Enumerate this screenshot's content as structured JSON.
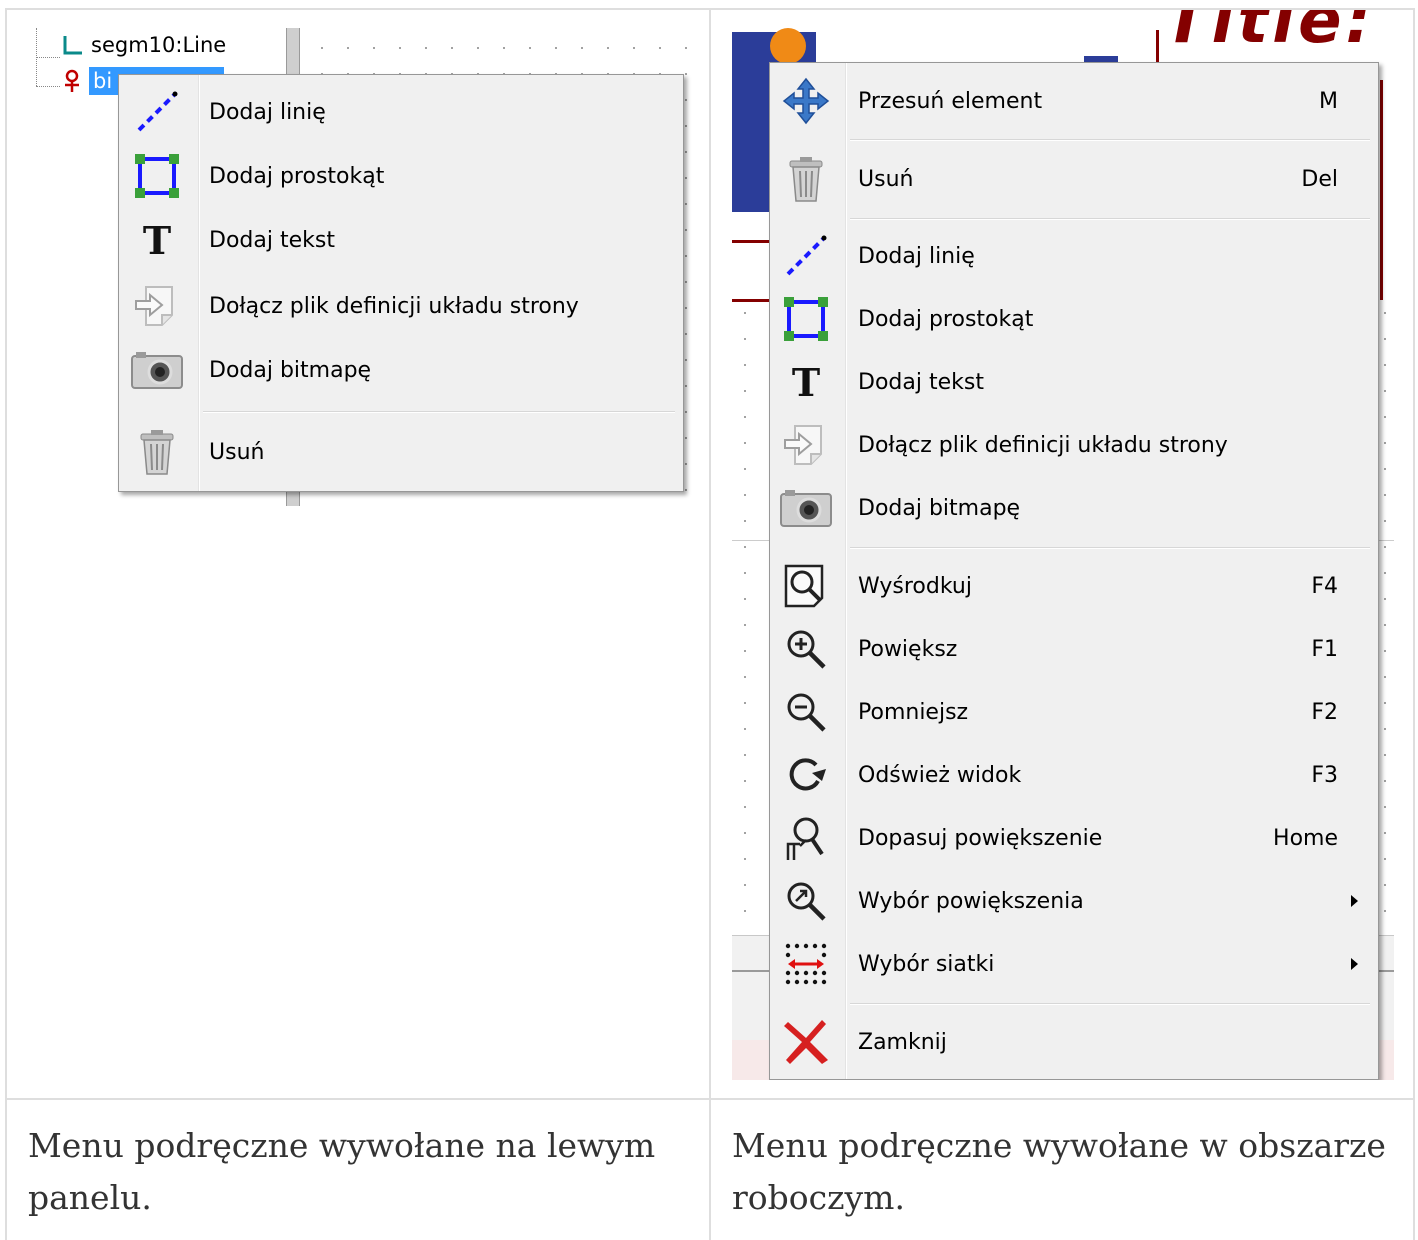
{
  "left": {
    "tree": {
      "item_1": "segm10:Line",
      "item_2": "bi"
    },
    "menu": [
      {
        "label": "Dodaj linię",
        "icon": "add-line-icon"
      },
      {
        "label": "Dodaj prostokąt",
        "icon": "add-rectangle-icon"
      },
      {
        "label": "Dodaj tekst",
        "icon": "add-text-icon"
      },
      {
        "label": "Dołącz plik definicji układu strony",
        "icon": "append-file-icon"
      },
      {
        "label": "Dodaj bitmapę",
        "icon": "camera-icon"
      },
      {
        "label": "Usuń",
        "icon": "trash-icon"
      }
    ],
    "caption": "Menu podręczne wywołane na lewym panelu."
  },
  "right": {
    "background": {
      "title_fragment": "Title:"
    },
    "menu": [
      {
        "label": "Przesuń element",
        "shortcut": "M",
        "icon": "move-icon"
      },
      {
        "label": "Usuń",
        "shortcut": "Del",
        "icon": "trash-icon"
      },
      {
        "label": "Dodaj linię",
        "shortcut": "",
        "icon": "add-line-icon"
      },
      {
        "label": "Dodaj prostokąt",
        "shortcut": "",
        "icon": "add-rectangle-icon"
      },
      {
        "label": "Dodaj tekst",
        "shortcut": "",
        "icon": "add-text-icon"
      },
      {
        "label": "Dołącz plik definicji układu strony",
        "shortcut": "",
        "icon": "append-file-icon"
      },
      {
        "label": "Dodaj bitmapę",
        "shortcut": "",
        "icon": "camera-icon"
      },
      {
        "label": "Wyśrodkuj",
        "shortcut": "F4",
        "icon": "zoom-center-icon"
      },
      {
        "label": "Powiększ",
        "shortcut": "F1",
        "icon": "zoom-in-icon"
      },
      {
        "label": "Pomniejsz",
        "shortcut": "F2",
        "icon": "zoom-out-icon"
      },
      {
        "label": "Odśwież widok",
        "shortcut": "F3",
        "icon": "refresh-icon"
      },
      {
        "label": "Dopasuj powiększenie",
        "shortcut": "Home",
        "icon": "zoom-fit-icon"
      },
      {
        "label": "Wybór powiększenia",
        "shortcut": "",
        "icon": "zoom-select-icon"
      },
      {
        "label": "Wybór siatki",
        "shortcut": "",
        "icon": "grid-select-icon"
      },
      {
        "label": "Zamknij",
        "shortcut": "",
        "icon": "close-icon"
      }
    ],
    "caption": "Menu podręczne wywołane w obszarze roboczym."
  },
  "colors": {
    "selection": "#3399ff",
    "menu_bg": "#f0f0f0",
    "caption_text": "#333333",
    "kicad_red": "#840000",
    "kicad_blue": "#2b3d99"
  }
}
